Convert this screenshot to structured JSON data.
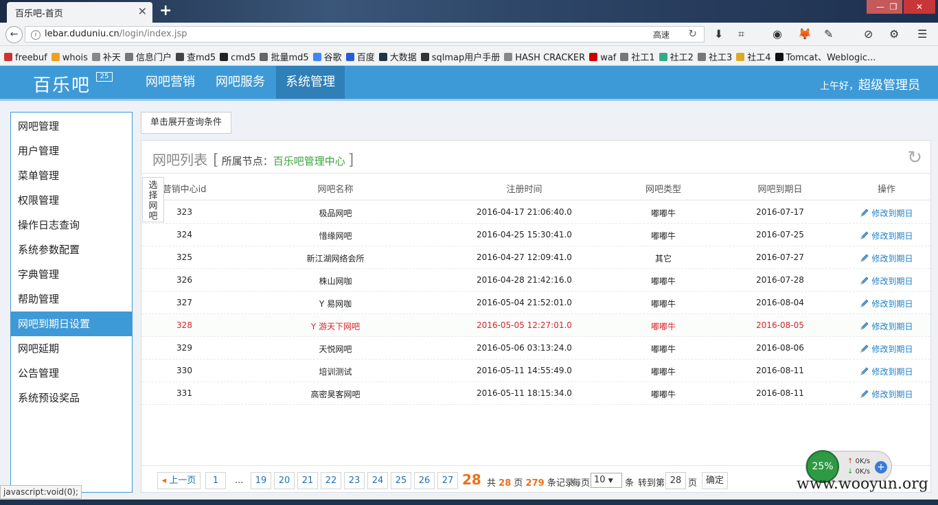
{
  "browser": {
    "tab_title": "百乐吧-首页",
    "tab_close": "✕",
    "new_tab": "+",
    "url_host": "lebar.duduniu.cn",
    "url_path": "/login/index.jsp",
    "speed_label": "高速",
    "window_controls": {
      "min": "—",
      "max": "❐",
      "close": "✕"
    },
    "bookmarks": [
      "freebuf",
      "whois",
      "补天",
      "信息门户",
      "查md5",
      "cmd5",
      "批量md5",
      "谷歌",
      "百度",
      "大数据",
      "sqlmap用户手册",
      "HASH CRACKER",
      "waf",
      "社工1",
      "社工2",
      "社工3",
      "社工4",
      "Tomcat、Weblogic..."
    ],
    "status_text": "javascript:void(0);"
  },
  "header": {
    "logo": "百乐吧",
    "logo_badge": "25",
    "nav": [
      "网吧营销",
      "网吧服务",
      "系统管理"
    ],
    "active_nav": "系统管理",
    "greeting_prefix": "上午好，",
    "greeting_user": "超级管理员"
  },
  "sidebar": {
    "items": [
      "网吧管理",
      "用户管理",
      "菜单管理",
      "权限管理",
      "操作日志查询",
      "系统参数配置",
      "字典管理",
      "帮助管理",
      "网吧到期日设置",
      "网吧延期",
      "公告管理",
      "系统预设奖品"
    ],
    "active": "网吧到期日设置"
  },
  "main": {
    "expand_button": "单击展开查询条件",
    "panel_title": "网吧列表",
    "node_label": "所属节点：",
    "node_value": "百乐吧管理中心",
    "select_tab": [
      "选",
      "择",
      "网",
      "吧"
    ],
    "columns": [
      "营销中心id",
      "网吧名称",
      "注册时间",
      "网吧类型",
      "网吧到期日",
      "操作"
    ],
    "rows": [
      {
        "id": "323",
        "name": "极品网吧",
        "reg": "2016-04-17 21:06:40.0",
        "type": "嘟嘟牛",
        "expire": "2016-07-17",
        "action": "修改到期日"
      },
      {
        "id": "324",
        "name": "惜缘网吧",
        "reg": "2016-04-25 15:30:41.0",
        "type": "嘟嘟牛",
        "expire": "2016-07-25",
        "action": "修改到期日"
      },
      {
        "id": "325",
        "name": "新江湖网络会所",
        "reg": "2016-04-27 12:09:41.0",
        "type": "其它",
        "expire": "2016-07-27",
        "action": "修改到期日"
      },
      {
        "id": "326",
        "name": "株山网咖",
        "reg": "2016-04-28 21:42:16.0",
        "type": "嘟嘟牛",
        "expire": "2016-07-28",
        "action": "修改到期日"
      },
      {
        "id": "327",
        "name": "Y 易网咖",
        "reg": "2016-05-04 21:52:01.0",
        "type": "嘟嘟牛",
        "expire": "2016-08-04",
        "action": "修改到期日"
      },
      {
        "id": "328",
        "name": "Y 游天下网吧",
        "reg": "2016-05-05 12:27:01.0",
        "type": "嘟嘟牛",
        "expire": "2016-08-05",
        "action": "修改到期日",
        "highlight": true
      },
      {
        "id": "329",
        "name": "天悦网吧",
        "reg": "2016-05-06 03:13:24.0",
        "type": "嘟嘟牛",
        "expire": "2016-08-06",
        "action": "修改到期日"
      },
      {
        "id": "330",
        "name": "培训测试",
        "reg": "2016-05-11 14:55:49.0",
        "type": "嘟嘟牛",
        "expire": "2016-08-11",
        "action": "修改到期日"
      },
      {
        "id": "331",
        "name": "高密昊客网吧",
        "reg": "2016-05-11 18:15:34.0",
        "type": "嘟嘟牛",
        "expire": "2016-08-11",
        "action": "修改到期日"
      }
    ]
  },
  "pager": {
    "prev": "上一页",
    "first": "1",
    "ellipsis": "...",
    "pages": [
      "19",
      "20",
      "21",
      "22",
      "23",
      "24",
      "25",
      "26",
      "27"
    ],
    "current": "28",
    "total_prefix": "共",
    "total_pages": "28",
    "pages_unit": "页",
    "total_records": "279",
    "records_unit": "条记录",
    "per_page_label": "每页",
    "per_page_value": "10",
    "per_page_unit": "条",
    "goto_label": "转到第",
    "goto_value": "28",
    "goto_unit": "页",
    "confirm": "确定"
  },
  "widget": {
    "percent": "25%",
    "up": "0K/s",
    "down": "0K/s"
  },
  "watermark": "www.wooyun.org"
}
